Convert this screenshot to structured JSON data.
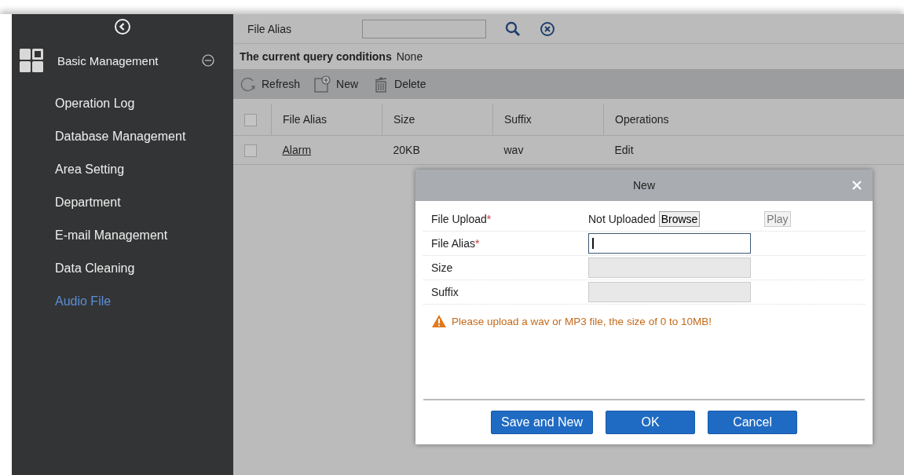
{
  "sidebar": {
    "group": {
      "label": "Basic Management",
      "expanded": true
    },
    "items": [
      {
        "label": "Operation Log",
        "selected": false
      },
      {
        "label": "Database Management",
        "selected": false
      },
      {
        "label": "Area Setting",
        "selected": false
      },
      {
        "label": "Department",
        "selected": false
      },
      {
        "label": "E-mail Management",
        "selected": false
      },
      {
        "label": "Data Cleaning",
        "selected": false
      },
      {
        "label": "Audio File",
        "selected": true
      }
    ]
  },
  "search": {
    "label": "File Alias"
  },
  "query": {
    "label": "The current query conditions",
    "value": "None"
  },
  "toolbar": [
    {
      "kind": "refresh",
      "label": "Refresh"
    },
    {
      "kind": "new",
      "label": "New"
    },
    {
      "kind": "delete",
      "label": "Delete"
    }
  ],
  "table": {
    "header_checked": false,
    "columns": [
      "File Alias",
      "Size",
      "Suffix",
      "Operations"
    ],
    "rows": [
      {
        "checked": false,
        "cells": [
          "Alarm",
          "20KB",
          "wav",
          "Edit"
        ]
      }
    ]
  },
  "dialog": {
    "title": "New",
    "fields": [
      {
        "kind": "upload",
        "label": "File Upload",
        "mark": "*",
        "status": "Not Uploaded",
        "browse": "Browse",
        "play": "Play"
      },
      {
        "kind": "input",
        "label": "File Alias",
        "mark": "*",
        "disabled": false,
        "focused": true
      },
      {
        "kind": "input",
        "label": "Size",
        "disabled": true,
        "focused": false
      },
      {
        "kind": "input",
        "label": "Suffix",
        "disabled": true,
        "focused": false
      }
    ],
    "warning": "Please upload a wav or MP3 file, the size of 0 to 10MB!",
    "buttons": [
      "Save and New",
      "OK",
      "Cancel"
    ]
  }
}
